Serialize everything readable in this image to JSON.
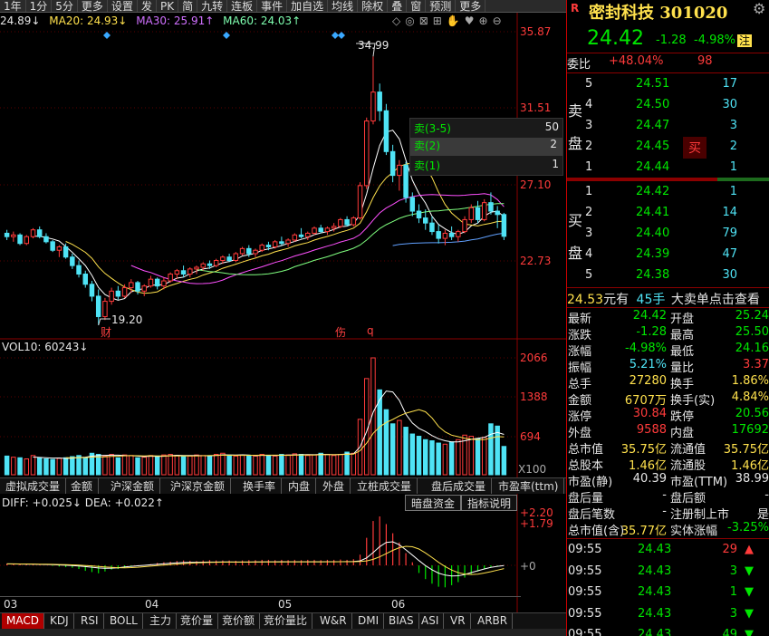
{
  "toolbar": {
    "items": [
      "1年",
      "1分",
      "5分",
      "更多",
      "设置",
      "发",
      "PK",
      "简",
      "九转",
      "连板",
      "事件",
      "加自选",
      "均线",
      "除权",
      "叠",
      "窗",
      "预测",
      "更多"
    ]
  },
  "ma_line": {
    "ma5": "24.89↓",
    "ma20": "MA20: 24.93↓",
    "ma30": "MA30: 25.91↑",
    "ma60": "MA60: 24.03↑"
  },
  "price_axis": {
    "labels": [
      "35.87",
      "31.51",
      "27.10",
      "22.73"
    ]
  },
  "annotations": {
    "high": "34.99",
    "low": "19.20",
    "marker_cai": "财",
    "marker_fu": "伤",
    "marker_q": "q"
  },
  "order_popup": {
    "rows": [
      {
        "label": "卖(3-5)",
        "value": "50"
      },
      {
        "label": "卖(2)",
        "value": "2"
      },
      {
        "label": "卖(1)",
        "value": "1"
      }
    ]
  },
  "vol": {
    "title": "VOL10: 60243↓",
    "axis": [
      "2066",
      "1388",
      "694",
      "X100"
    ]
  },
  "mid_tabs": [
    "虚拟成交量",
    "金额",
    "沪深金额",
    "沪深京金额",
    "换手率",
    "内盘",
    "外盘",
    "立桩成交量",
    "盘后成交量",
    "市盈率(ttm)"
  ],
  "macd": {
    "title": "DIFF: +0.025↓ DEA: +0.022↑",
    "buttons": [
      "暗盘资金",
      "指标说明"
    ],
    "axis": [
      "+2.20",
      "+1.79",
      "+0"
    ]
  },
  "dates": [
    "03",
    "04",
    "05",
    "06"
  ],
  "bottom_tabs": [
    "MACD",
    "KDJ",
    "RSI",
    "BOLL",
    "主力",
    "竞价量",
    "竞价额",
    "竞价量比",
    "W&R",
    "DMI",
    "BIAS",
    "ASI",
    "VR",
    "ARBR"
  ],
  "quote": {
    "name": "密封科技",
    "code": "301020",
    "price": "24.42",
    "change": "-1.28",
    "pct": "-4.98%",
    "badge": "注",
    "weibi_label": "委比",
    "weibi": "+48.04%",
    "weicha": "98",
    "sell_label": "卖盘",
    "buy_label": "买盘",
    "asks": [
      {
        "lvl": "5",
        "px": "24.51",
        "vol": "17"
      },
      {
        "lvl": "4",
        "px": "24.50",
        "vol": "30"
      },
      {
        "lvl": "3",
        "px": "24.47",
        "vol": "3"
      },
      {
        "lvl": "2",
        "px": "24.45",
        "vol": "2",
        "tag": "买"
      },
      {
        "lvl": "1",
        "px": "24.44",
        "vol": "1"
      }
    ],
    "bids": [
      {
        "lvl": "1",
        "px": "24.42",
        "vol": "1"
      },
      {
        "lvl": "2",
        "px": "24.41",
        "vol": "14"
      },
      {
        "lvl": "3",
        "px": "24.40",
        "vol": "79"
      },
      {
        "lvl": "4",
        "px": "24.39",
        "vol": "47"
      },
      {
        "lvl": "5",
        "px": "24.38",
        "vol": "30"
      }
    ],
    "bigorder": {
      "price": "24.53",
      "text1": "元有",
      "hands": "45手",
      "text2": "大卖单点击查看"
    },
    "stats": [
      {
        "l1": "最新",
        "v1": "24.42",
        "c1": "green",
        "l2": "开盘",
        "v2": "25.24",
        "c2": "green"
      },
      {
        "l1": "涨跌",
        "v1": "-1.28",
        "c1": "green",
        "l2": "最高",
        "v2": "25.50",
        "c2": "green"
      },
      {
        "l1": "涨幅",
        "v1": "-4.98%",
        "c1": "green",
        "l2": "最低",
        "v2": "24.16",
        "c2": "green"
      },
      {
        "l1": "振幅",
        "v1": "5.21%",
        "c1": "cyan",
        "l2": "量比",
        "v2": "3.37",
        "c2": "red"
      },
      {
        "l1": "总手",
        "v1": "27280",
        "c1": "yellow",
        "l2": "换手",
        "v2": "1.86%",
        "c2": "yellow"
      },
      {
        "l1": "金额",
        "v1": "6707万",
        "c1": "yellow",
        "l2": "换手(实)",
        "v2": "4.84%",
        "c2": "yellow"
      },
      {
        "l1": "涨停",
        "v1": "30.84",
        "c1": "red",
        "l2": "跌停",
        "v2": "20.56",
        "c2": "green"
      },
      {
        "l1": "外盘",
        "v1": "9588",
        "c1": "red",
        "l2": "内盘",
        "v2": "17692",
        "c2": "green"
      },
      {
        "l1": "总市值",
        "v1": "35.75亿",
        "c1": "yellow",
        "l2": "流通值",
        "v2": "35.75亿",
        "c2": "yellow"
      },
      {
        "l1": "总股本",
        "v1": "1.46亿",
        "c1": "yellow",
        "l2": "流通股",
        "v2": "1.46亿",
        "c2": "yellow"
      },
      {
        "l1": "市盈(静)",
        "v1": "40.39",
        "c1": "white",
        "l2": "市盈(TTM)",
        "v2": "38.99",
        "c2": "white"
      },
      {
        "l1": "盘后量",
        "v1": "-",
        "c1": "white",
        "l2": "盘后额",
        "v2": "-",
        "c2": "white"
      },
      {
        "l1": "盘后笔数",
        "v1": "-",
        "c1": "white",
        "l2": "注册制上市",
        "v2": "是",
        "c2": "white"
      },
      {
        "l1": "总市值(含)",
        "v1": "35.77亿",
        "c1": "yellow",
        "l2": "实体涨幅",
        "v2": "-3.25%",
        "c2": "green"
      }
    ],
    "ticks": [
      {
        "t": "09:55",
        "px": "24.43",
        "vol": "29",
        "dir": "up"
      },
      {
        "t": "09:55",
        "px": "24.43",
        "vol": "3",
        "dir": "down"
      },
      {
        "t": "09:55",
        "px": "24.43",
        "vol": "1",
        "dir": "down"
      },
      {
        "t": "09:55",
        "px": "24.43",
        "vol": "3",
        "dir": "down"
      },
      {
        "t": "09:55",
        "px": "24.43",
        "vol": "49",
        "dir": "down"
      }
    ]
  },
  "chart_data": {
    "type": "candlestick",
    "ylim": [
      18.5,
      36.5
    ],
    "candles": [
      [
        24.6,
        24.8,
        24.2,
        24.4
      ],
      [
        24.4,
        24.7,
        24.1,
        24.5
      ],
      [
        24.5,
        24.6,
        23.9,
        24.0
      ],
      [
        24.0,
        24.5,
        23.9,
        24.4
      ],
      [
        24.4,
        24.9,
        24.3,
        24.8
      ],
      [
        24.8,
        25.0,
        24.3,
        24.4
      ],
      [
        24.4,
        24.6,
        24.0,
        24.1
      ],
      [
        24.1,
        24.2,
        23.5,
        23.6
      ],
      [
        23.6,
        23.9,
        23.2,
        23.8
      ],
      [
        23.8,
        24.0,
        23.1,
        23.2
      ],
      [
        23.2,
        23.4,
        22.5,
        22.7
      ],
      [
        22.7,
        23.0,
        22.0,
        22.2
      ],
      [
        22.2,
        22.4,
        21.4,
        21.6
      ],
      [
        21.6,
        21.8,
        20.6,
        20.9
      ],
      [
        20.9,
        21.3,
        19.2,
        19.7
      ],
      [
        19.7,
        20.8,
        19.5,
        20.6
      ],
      [
        20.6,
        21.4,
        20.4,
        21.2
      ],
      [
        21.2,
        21.5,
        20.7,
        20.9
      ],
      [
        20.9,
        21.6,
        20.8,
        21.4
      ],
      [
        21.4,
        21.9,
        21.1,
        21.7
      ],
      [
        21.7,
        21.8,
        21.0,
        21.2
      ],
      [
        21.2,
        21.6,
        20.9,
        21.5
      ],
      [
        21.5,
        22.1,
        21.4,
        21.9
      ],
      [
        21.9,
        22.0,
        21.3,
        21.5
      ],
      [
        21.5,
        22.0,
        21.3,
        21.8
      ],
      [
        21.8,
        22.3,
        21.7,
        22.2
      ],
      [
        22.2,
        22.5,
        21.9,
        22.4
      ],
      [
        22.4,
        22.7,
        22.0,
        22.2
      ],
      [
        22.2,
        22.6,
        22.0,
        22.5
      ],
      [
        22.5,
        22.7,
        22.2,
        22.6
      ],
      [
        22.6,
        22.9,
        22.4,
        22.8
      ],
      [
        22.8,
        23.0,
        22.5,
        22.7
      ],
      [
        22.7,
        23.1,
        22.6,
        23.0
      ],
      [
        23.0,
        23.3,
        22.8,
        23.2
      ],
      [
        23.2,
        23.4,
        22.9,
        23.0
      ],
      [
        23.0,
        23.5,
        22.9,
        23.4
      ],
      [
        23.4,
        23.8,
        23.3,
        23.7
      ],
      [
        23.7,
        23.9,
        23.2,
        23.4
      ],
      [
        23.4,
        23.7,
        23.2,
        23.6
      ],
      [
        23.6,
        24.0,
        23.5,
        23.9
      ],
      [
        23.9,
        24.1,
        23.6,
        23.8
      ],
      [
        23.8,
        24.2,
        23.7,
        24.1
      ],
      [
        24.1,
        24.4,
        23.9,
        24.0
      ],
      [
        24.0,
        24.3,
        23.8,
        24.2
      ],
      [
        24.2,
        24.6,
        24.1,
        24.5
      ],
      [
        24.5,
        24.9,
        24.3,
        24.4
      ],
      [
        24.4,
        24.7,
        24.2,
        24.6
      ],
      [
        24.6,
        25.0,
        24.5,
        24.9
      ],
      [
        24.9,
        25.1,
        24.6,
        24.7
      ],
      [
        24.7,
        25.0,
        24.5,
        24.9
      ],
      [
        24.9,
        25.2,
        24.7,
        25.0
      ],
      [
        25.0,
        25.5,
        24.9,
        25.4
      ],
      [
        25.4,
        25.6,
        25.0,
        25.1
      ],
      [
        25.1,
        25.6,
        25.0,
        25.5
      ],
      [
        25.5,
        27.6,
        25.4,
        27.4
      ],
      [
        27.4,
        31.4,
        27.2,
        31.2
      ],
      [
        31.2,
        34.99,
        31.0,
        32.9
      ],
      [
        32.9,
        33.4,
        31.2,
        31.8
      ],
      [
        31.8,
        32.2,
        29.2,
        29.4
      ],
      [
        29.4,
        29.8,
        27.6,
        28.0
      ],
      [
        28.0,
        28.9,
        27.1,
        28.6
      ],
      [
        28.6,
        28.8,
        26.4,
        26.7
      ],
      [
        26.7,
        27.0,
        25.6,
        25.9
      ],
      [
        25.9,
        26.3,
        25.2,
        25.5
      ],
      [
        25.5,
        26.0,
        24.8,
        25.2
      ],
      [
        25.2,
        25.6,
        24.5,
        24.7
      ],
      [
        24.7,
        25.1,
        24.0,
        24.3
      ],
      [
        24.3,
        24.8,
        23.9,
        24.6
      ],
      [
        24.6,
        25.0,
        24.2,
        24.4
      ],
      [
        24.4,
        24.8,
        24.1,
        24.7
      ],
      [
        24.7,
        25.6,
        24.6,
        25.4
      ],
      [
        25.4,
        26.3,
        25.2,
        26.1
      ],
      [
        26.1,
        26.5,
        25.2,
        25.4
      ],
      [
        25.4,
        26.6,
        25.3,
        26.4
      ],
      [
        26.4,
        27.0,
        25.7,
        25.9
      ],
      [
        25.9,
        26.2,
        24.9,
        25.7
      ],
      [
        25.7,
        25.8,
        24.2,
        24.42
      ]
    ],
    "volume": [
      330,
      310,
      300,
      280,
      340,
      300,
      280,
      270,
      290,
      300,
      320,
      340,
      300,
      380,
      360,
      330,
      360,
      300,
      350,
      340,
      300,
      310,
      340,
      330,
      350,
      360,
      340,
      320,
      330,
      350,
      340,
      330,
      360,
      380,
      340,
      330,
      350,
      340,
      330,
      360,
      340,
      330,
      360,
      350,
      370,
      360,
      340,
      350,
      380,
      360,
      340,
      360,
      400,
      380,
      980,
      1700,
      2066,
      1500,
      1150,
      900,
      960,
      840,
      720,
      680,
      620,
      600,
      560,
      540,
      580,
      620,
      700,
      680,
      640,
      660,
      900,
      860,
      500
    ],
    "macd_hist": [
      0.05,
      0.04,
      0.03,
      0.02,
      0.02,
      0.01,
      0.0,
      -0.02,
      -0.04,
      -0.06,
      -0.08,
      -0.12,
      -0.18,
      -0.22,
      -0.26,
      -0.2,
      -0.14,
      -0.12,
      -0.08,
      -0.04,
      -0.02,
      0.0,
      0.04,
      0.08,
      0.1,
      0.12,
      0.14,
      0.16,
      0.15,
      0.14,
      0.16,
      0.17,
      0.16,
      0.16,
      0.16,
      0.15,
      0.16,
      0.17,
      0.17,
      0.18,
      0.18,
      0.17,
      0.18,
      0.17,
      0.18,
      0.17,
      0.18,
      0.18,
      0.17,
      0.18,
      0.18,
      0.19,
      0.18,
      0.2,
      0.35,
      0.9,
      1.45,
      1.6,
      1.35,
      1.05,
      0.75,
      0.4,
      0.1,
      -0.25,
      -0.45,
      -0.6,
      -0.7,
      -0.72,
      -0.65,
      -0.55,
      -0.4,
      -0.28,
      -0.2,
      -0.12,
      -0.05,
      -0.02,
      0.006
    ]
  }
}
